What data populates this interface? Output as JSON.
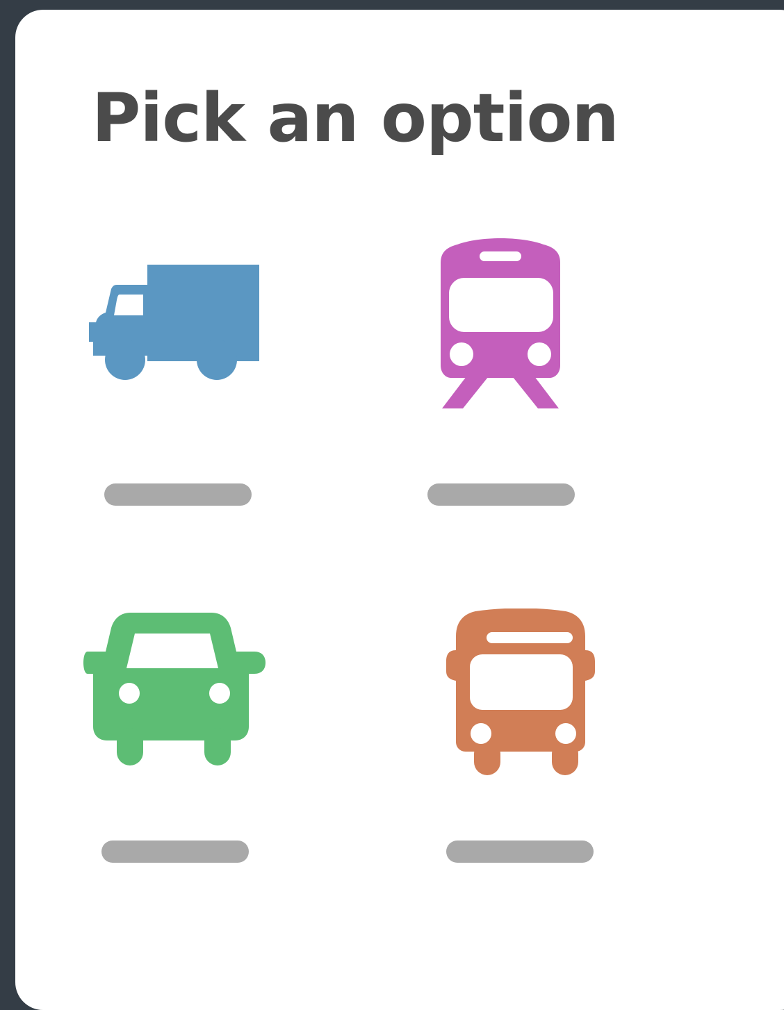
{
  "dialog": {
    "title": "Pick an option"
  },
  "options": [
    {
      "id": "truck",
      "icon": "truck-icon",
      "color": "#5b97c2",
      "label": ""
    },
    {
      "id": "train",
      "icon": "train-icon",
      "color": "#c45fbc",
      "label": ""
    },
    {
      "id": "car",
      "icon": "car-icon",
      "color": "#5dbd74",
      "label": ""
    },
    {
      "id": "bus",
      "icon": "bus-icon",
      "color": "#d17e56",
      "label": ""
    }
  ],
  "colors": {
    "background": "#343d46",
    "card": "#ffffff",
    "title": "#4b4b4b",
    "label_placeholder": "#a9a9a9"
  }
}
